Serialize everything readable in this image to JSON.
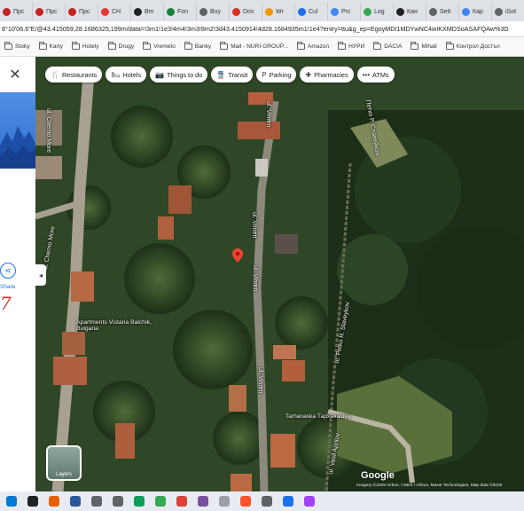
{
  "tabs": [
    {
      "label": "Прс",
      "color": "#c5221f"
    },
    {
      "label": "Прс",
      "color": "#c5221f"
    },
    {
      "label": "Прс",
      "color": "#c5221f"
    },
    {
      "label": "CH",
      "color": "#e53935"
    },
    {
      "label": "Bm",
      "color": "#202124"
    },
    {
      "label": "Fon",
      "color": "#188038"
    },
    {
      "label": "Buy",
      "color": "#5f6368"
    },
    {
      "label": "Dov",
      "color": "#d93025"
    },
    {
      "label": "Wr",
      "color": "#f29900"
    },
    {
      "label": "Cul",
      "color": "#1a73e8"
    },
    {
      "label": "Prc",
      "color": "#4285f4"
    },
    {
      "label": "Log",
      "color": "#34a853"
    },
    {
      "label": "Кан",
      "color": "#202124"
    },
    {
      "label": "Sett",
      "color": "#5f6368"
    },
    {
      "label": "Кар",
      "color": "#4285f4"
    },
    {
      "label": "iSot",
      "color": "#5f6368"
    }
  ],
  "address": {
    "url": "8°10'06.6\"E/@43.415059,28.1686325,199m/data=!3m1!1e3!4m4!3m3!8m2!3d43.4150914!4d28.1684935m1!1e4?entry=ttu&g_ep=EgoyMDI1MDYwNC4wIKXMDSoASAFQAw%3D"
  },
  "bookmarks": [
    {
      "label": "Stoky",
      "icon": "folder-icon"
    },
    {
      "label": "Karty",
      "icon": "folder-icon"
    },
    {
      "label": "Hotely",
      "icon": "folder-icon"
    },
    {
      "label": "Drugy",
      "icon": "folder-icon"
    },
    {
      "label": "Vremeto",
      "icon": "folder-icon"
    },
    {
      "label": "Banky",
      "icon": "folder-icon"
    },
    {
      "label": "Mail - NURI GROUP...",
      "icon": "mail-icon"
    },
    {
      "label": "Amazon",
      "icon": "folder-icon"
    },
    {
      "label": "НУРИ",
      "icon": "folder-icon"
    },
    {
      "label": "DACIA",
      "icon": "folder-icon"
    },
    {
      "label": "Mihail",
      "icon": "folder-icon"
    },
    {
      "label": "Контрол Достъп",
      "icon": "folder-icon"
    }
  ],
  "left_panel": {
    "close_glyph": "✕",
    "share_label": "Share",
    "share_glyph": "⋖",
    "red_text": "7",
    "collapse_glyph": "◂"
  },
  "map": {
    "chips": [
      {
        "label": "Restaurants",
        "icon": "🍴"
      },
      {
        "label": "Hotels",
        "icon": "🛏"
      },
      {
        "label": "Things to do",
        "icon": "📷"
      },
      {
        "label": "Transit",
        "icon": "🚆"
      },
      {
        "label": "Parking",
        "icon": "P"
      },
      {
        "label": "Pharmacies",
        "icon": "✚"
      },
      {
        "label": "ATMs",
        "icon": "•••"
      }
    ],
    "street_labels": {
      "cherno_more_top": "ul. Cherno More",
      "cherno_more_bottom": "ul. Cherno More",
      "vihren_top": "ul. Vihren",
      "vihren_mid": "ul. Vihren",
      "vihren_low": "ul. Vihren",
      "vihren_bottom": "ul. Vihren",
      "petko_cyr": "Петко Р. Славейков",
      "petko_lat": "ul. Petko R. Slaveykov",
      "vasil_aprilov": "ul. Vasil Aprilov"
    },
    "places": {
      "apartments": "Apartments Vistaria Balchik, Bulgaria",
      "tarhanashka": "Tarhanaska Тарханашка"
    },
    "layers_label": "Layers",
    "google_logo": "Google",
    "attribution": "Imagery ©2025 Airbus, CNES / Airbus, Maxar Technologies, Map data ©2025"
  },
  "taskbar": [
    {
      "icon": "windows-start-icon",
      "color": "#0078d4"
    },
    {
      "icon": "speedometer-icon",
      "color": "#202124"
    },
    {
      "icon": "firefox-icon",
      "color": "#e66000"
    },
    {
      "icon": "word-icon",
      "color": "#2b579a"
    },
    {
      "icon": "stick-icon",
      "color": "#5f6368"
    },
    {
      "icon": "files-icon",
      "color": "#5f6368"
    },
    {
      "icon": "edge-icon",
      "color": "#0f9d58"
    },
    {
      "icon": "chrome-icon",
      "color": "#34a853"
    },
    {
      "icon": "chrome-icon",
      "color": "#db4437"
    },
    {
      "icon": "viber-icon",
      "color": "#7b519d"
    },
    {
      "icon": "app-icon",
      "color": "#9aa0a6"
    },
    {
      "icon": "brave-icon",
      "color": "#fb542b"
    },
    {
      "icon": "monitor-icon",
      "color": "#5f6368"
    },
    {
      "icon": "mail-icon",
      "color": "#1a73e8"
    },
    {
      "icon": "app-icon",
      "color": "#a142f4"
    }
  ]
}
